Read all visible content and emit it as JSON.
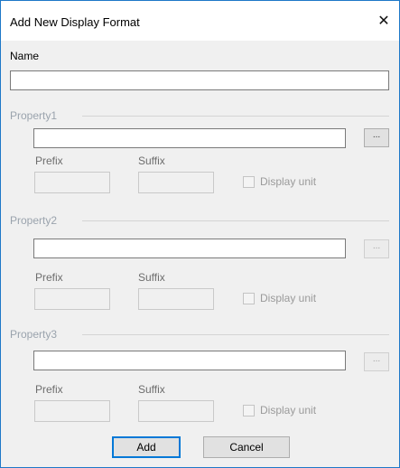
{
  "dialog": {
    "title": "Add New Display Format",
    "close_glyph": "✕",
    "name_label": "Name",
    "name_value": ""
  },
  "groups": [
    {
      "title": "Property1",
      "value": "",
      "browse_label": "...",
      "prefix_label": "Prefix",
      "suffix_label": "Suffix",
      "prefix_value": "",
      "suffix_value": "",
      "display_unit_label": "Display unit",
      "display_unit_checked": false
    },
    {
      "title": "Property2",
      "value": "",
      "browse_label": "...",
      "prefix_label": "Prefix",
      "suffix_label": "Suffix",
      "prefix_value": "",
      "suffix_value": "",
      "display_unit_label": "Display unit",
      "display_unit_checked": false
    },
    {
      "title": "Property3",
      "value": "",
      "browse_label": "...",
      "prefix_label": "Prefix",
      "suffix_label": "Suffix",
      "prefix_value": "",
      "suffix_value": "",
      "display_unit_label": "Display unit",
      "display_unit_checked": false
    }
  ],
  "buttons": {
    "add_label": "Add",
    "cancel_label": "Cancel"
  },
  "colors": {
    "accent": "#0078d7",
    "window_border": "#1e78c8",
    "disabled_text": "#9aa3ad"
  }
}
